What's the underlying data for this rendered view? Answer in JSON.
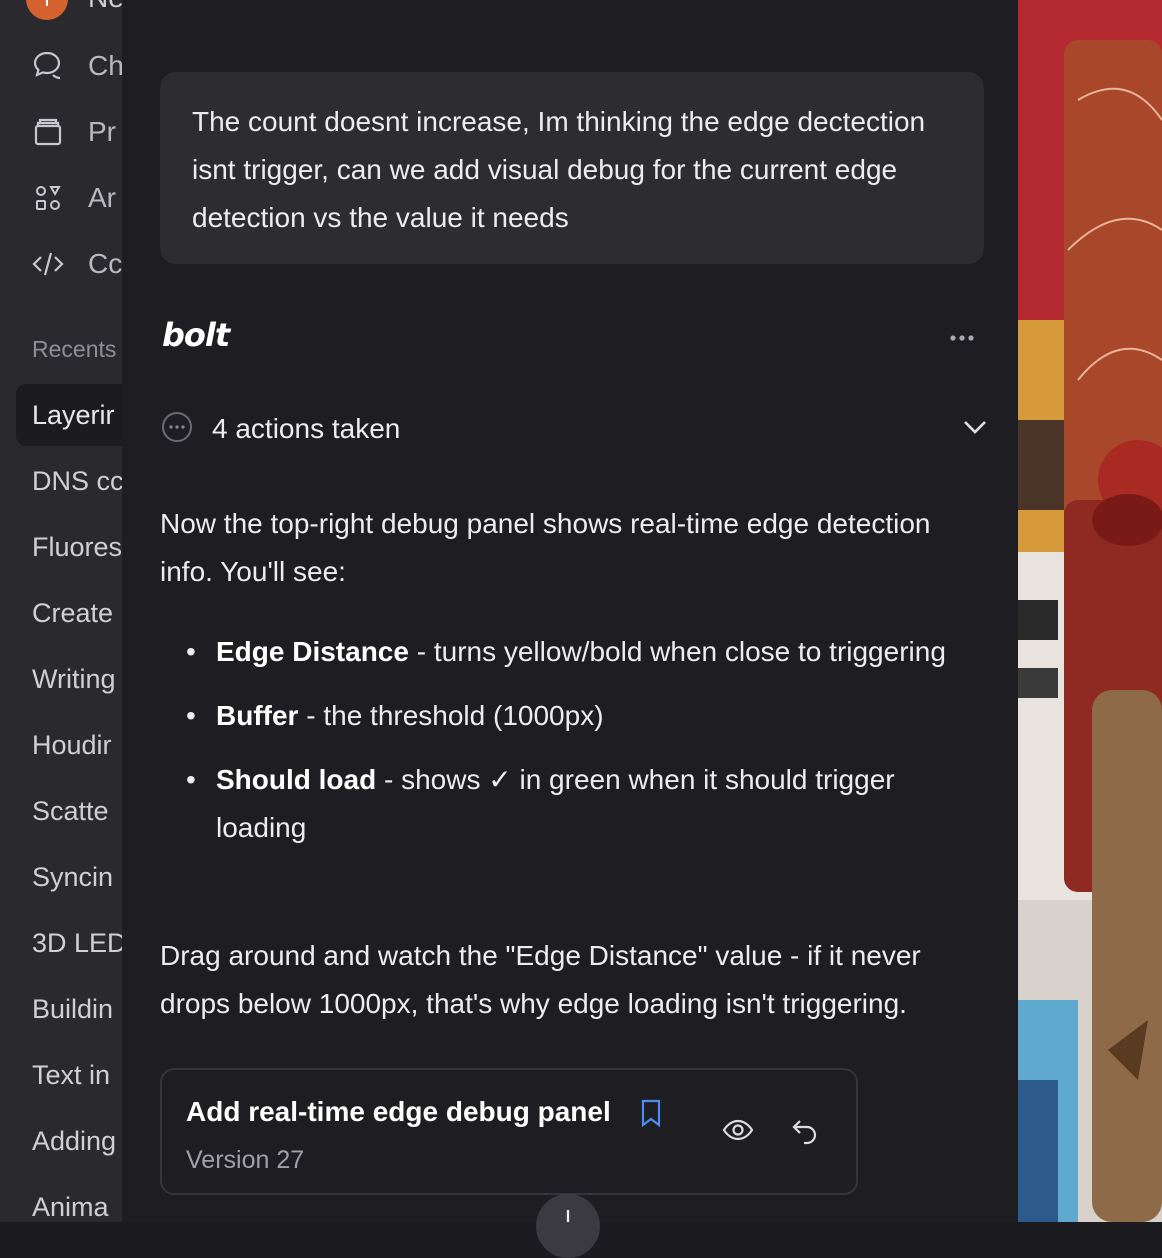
{
  "sidebar": {
    "avatar_letter": "T",
    "avatar_label": "Ne",
    "nav": [
      {
        "label": "Ch",
        "icon": "chat-icon"
      },
      {
        "label": "Pr",
        "icon": "projects-icon"
      },
      {
        "label": "Ar",
        "icon": "artifacts-icon"
      },
      {
        "label": "Cc",
        "icon": "code-icon"
      }
    ],
    "recents_title": "Recents",
    "recents": [
      "Layerir",
      "DNS cc",
      "Fluores",
      "Create",
      "Writing",
      "Houdir",
      "Scatte",
      "Syncin",
      "3D LED",
      "Buildin",
      "Text in",
      "Adding",
      "Anima"
    ]
  },
  "chat": {
    "user_message": "The count doesnt increase, Im thinking the edge dectection isnt trigger, can we add visual debug for the current edge detection vs the value it needs",
    "assistant_name": "bolt",
    "actions_label": "4 actions taken",
    "intro": "Now the top-right debug panel shows real-time edge detection info. You'll see:",
    "bullets": [
      {
        "bold": "Edge Distance",
        "text": " - turns yellow/bold when close to triggering"
      },
      {
        "bold": "Buffer",
        "text": " - the threshold (1000px)"
      },
      {
        "bold": "Should load",
        "text": " - shows ✓ in green when it should trigger loading"
      }
    ],
    "outro": "Drag around and watch the \"Edge Distance\" value - if it never drops below 1000px, that's why edge loading isn't triggering.",
    "version_card": {
      "title": "Add real-time edge debug panel",
      "subtitle": "Version 27"
    }
  }
}
